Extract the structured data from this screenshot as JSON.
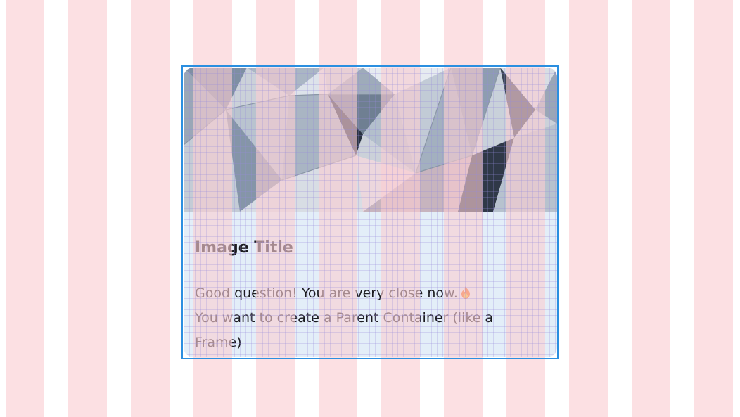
{
  "card": {
    "title": "Image Title",
    "body_line_1": "Good question! You are very close now.",
    "body_line_2": " You want to create a Parent Container (like a",
    "body_line_3": "Frame)",
    "emoji_icon": "fire-icon"
  },
  "colors": {
    "layout_grid_column": "#facdd2",
    "card_background": "#e3eef8",
    "selection_border": "#2b8fe0",
    "pixel_grid": "#968cdc",
    "text": "#1b1b1f"
  }
}
